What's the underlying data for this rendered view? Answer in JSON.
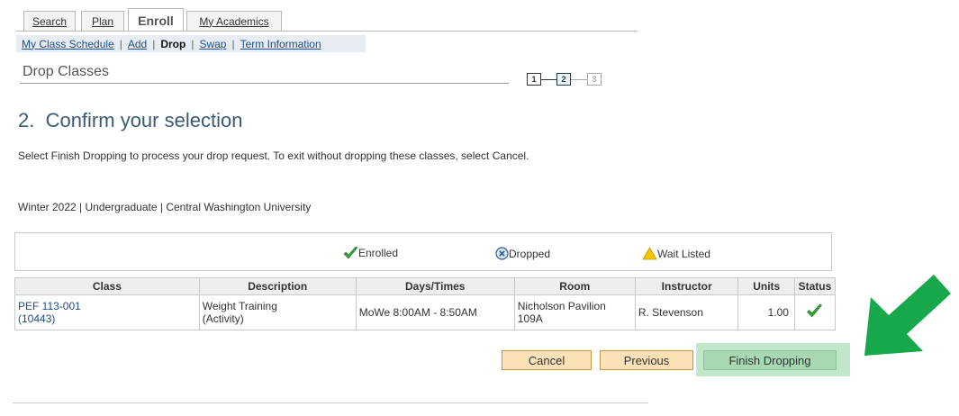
{
  "tabs": [
    {
      "label": "Search"
    },
    {
      "label": "Plan"
    },
    {
      "label": "Enroll"
    },
    {
      "label": "My Academics"
    }
  ],
  "subnav": {
    "items": [
      "My Class Schedule",
      "Add",
      "Drop",
      "Swap",
      "Term Information"
    ],
    "separator": "|"
  },
  "page_title": "Drop Classes",
  "steps": [
    "1",
    "2",
    "3"
  ],
  "section_heading": "2.  Confirm your selection",
  "instructions": "Select Finish Dropping to process your drop request. To exit without dropping these classes, select Cancel.",
  "term_info": "Winter 2022 | Undergraduate | Central Washington University",
  "legend": {
    "enrolled": "Enrolled",
    "dropped": "Dropped",
    "wait_listed": "Wait Listed"
  },
  "table": {
    "headers": [
      "Class",
      "Description",
      "Days/Times",
      "Room",
      "Instructor",
      "Units",
      "Status"
    ],
    "rows": [
      {
        "class_code": "PEF 113-001",
        "class_number": "(10443)",
        "description_1": "Weight Training",
        "description_2": "(Activity)",
        "days_times": "MoWe 8:00AM - 8:50AM",
        "room_1": "Nicholson Pavilion",
        "room_2": "109A",
        "instructor": "R. Stevenson",
        "units": "1.00",
        "status_icon": "checkmark-icon"
      }
    ]
  },
  "buttons": {
    "cancel": "Cancel",
    "previous": "Previous",
    "finish": "Finish Dropping"
  },
  "colors": {
    "accent_link": "#1e4b8a",
    "heading": "#3c5a78",
    "button_bg": "#fbe2b6",
    "finish_bg": "#a7d8b3",
    "arrow": "#16a84a"
  }
}
